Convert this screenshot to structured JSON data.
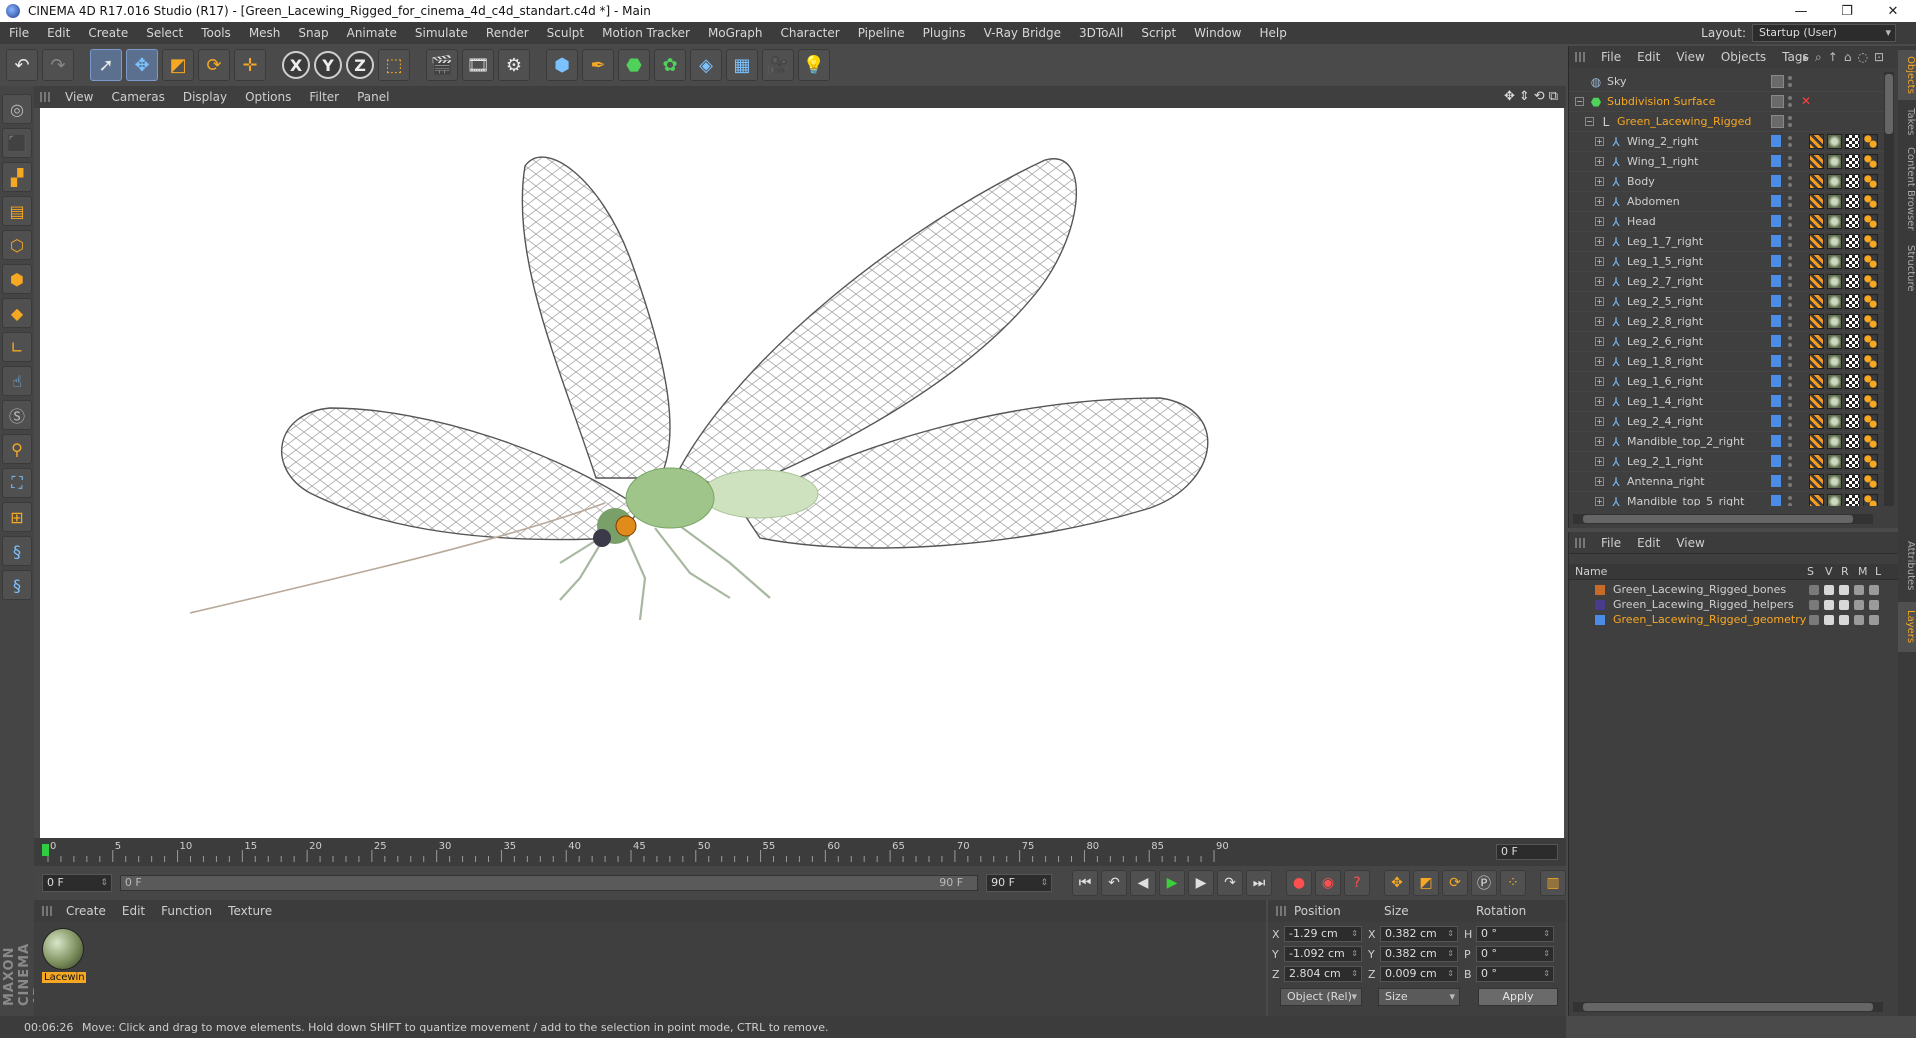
{
  "window": {
    "title": "CINEMA 4D R17.016 Studio (R17) - [Green_Lacewing_Rigged_for_cinema_4d_c4d_standart.c4d *] - Main",
    "controls": [
      "—",
      "❐",
      "✕"
    ]
  },
  "menubar": {
    "items": [
      "File",
      "Edit",
      "Create",
      "Select",
      "Tools",
      "Mesh",
      "Snap",
      "Animate",
      "Simulate",
      "Render",
      "Sculpt",
      "Motion Tracker",
      "MoGraph",
      "Character",
      "Pipeline",
      "Plugins",
      "V-Ray Bridge",
      "3DToAll",
      "Script",
      "Window",
      "Help"
    ],
    "layout_label": "Layout:",
    "layout_value": "Startup (User)"
  },
  "toolbar": {
    "icons": [
      "undo-icon",
      "redo-icon",
      "select-arrow-icon",
      "move-icon",
      "scale-icon",
      "rotate-icon",
      "live-move-icon",
      "x-axis-icon",
      "y-axis-icon",
      "z-axis-icon",
      "coordinate-system-icon",
      "render-view-icon",
      "render-picture-viewer-icon",
      "render-settings-icon",
      "cube-icon",
      "pen-icon",
      "subdivision-icon",
      "cloner-icon",
      "deformer-icon",
      "floor-icon",
      "camera-icon",
      "light-icon"
    ],
    "axis_labels": [
      "X",
      "Y",
      "Z"
    ]
  },
  "viewport": {
    "menu": [
      "View",
      "Cameras",
      "Display",
      "Options",
      "Filter",
      "Panel"
    ],
    "nav_icons": [
      "✥",
      "⇕",
      "⟲",
      "⧉"
    ]
  },
  "timeline": {
    "ticks": [
      "0",
      "5",
      "10",
      "15",
      "20",
      "25",
      "30",
      "35",
      "40",
      "45",
      "50",
      "55",
      "60",
      "65",
      "70",
      "75",
      "80",
      "85",
      "90"
    ],
    "current_frame": "0 F"
  },
  "transport": {
    "start_field": "0 F",
    "range_left": "0 F",
    "range_right": "90 F",
    "end_field": "90 F"
  },
  "material_manager": {
    "menu": [
      "Create",
      "Edit",
      "Function",
      "Texture"
    ],
    "materials": [
      {
        "label": "Lacewin"
      }
    ]
  },
  "coordinates": {
    "headers": [
      "Position",
      "Size",
      "Rotation"
    ],
    "rows": [
      {
        "axis": "X",
        "pos": "-1.29 cm",
        "size_axis": "X",
        "size": "0.382 cm",
        "rot_axis": "H",
        "rot": "0 °"
      },
      {
        "axis": "Y",
        "pos": "-1.092 cm",
        "size_axis": "Y",
        "size": "0.382 cm",
        "rot_axis": "P",
        "rot": "0 °"
      },
      {
        "axis": "Z",
        "pos": "2.804 cm",
        "size_axis": "Z",
        "size": "0.009 cm",
        "rot_axis": "B",
        "rot": "0 °"
      }
    ],
    "mode": "Object (Rel)",
    "size_mode": "Size",
    "apply": "Apply"
  },
  "statusbar": {
    "time": "00:06:26",
    "message": "Move: Click and drag to move elements. Hold down SHIFT to quantize movement / add to the selection in point mode, CTRL to remove."
  },
  "object_manager": {
    "menu": [
      "File",
      "Edit",
      "View",
      "Objects",
      "Tags"
    ],
    "objects": [
      {
        "name": "Sky",
        "depth": 0,
        "kind": "sky",
        "orange": false,
        "expand": ""
      },
      {
        "name": "Subdivision Surface",
        "depth": 0,
        "kind": "subd",
        "orange": true,
        "expand": "−"
      },
      {
        "name": "Green_Lacewing_Rigged",
        "depth": 1,
        "kind": "null",
        "orange": true,
        "expand": "−"
      },
      {
        "name": "Wing_2_right",
        "depth": 2,
        "kind": "joint",
        "orange": false,
        "expand": "+"
      },
      {
        "name": "Wing_1_right",
        "depth": 2,
        "kind": "joint",
        "orange": false,
        "expand": "+"
      },
      {
        "name": "Body",
        "depth": 2,
        "kind": "joint",
        "orange": false,
        "expand": "+"
      },
      {
        "name": "Abdomen",
        "depth": 2,
        "kind": "joint",
        "orange": false,
        "expand": "+"
      },
      {
        "name": "Head",
        "depth": 2,
        "kind": "joint",
        "orange": false,
        "expand": "+"
      },
      {
        "name": "Leg_1_7_right",
        "depth": 2,
        "kind": "joint",
        "orange": false,
        "expand": "+"
      },
      {
        "name": "Leg_1_5_right",
        "depth": 2,
        "kind": "joint",
        "orange": false,
        "expand": "+"
      },
      {
        "name": "Leg_2_7_right",
        "depth": 2,
        "kind": "joint",
        "orange": false,
        "expand": "+"
      },
      {
        "name": "Leg_2_5_right",
        "depth": 2,
        "kind": "joint",
        "orange": false,
        "expand": "+"
      },
      {
        "name": "Leg_2_8_right",
        "depth": 2,
        "kind": "joint",
        "orange": false,
        "expand": "+"
      },
      {
        "name": "Leg_2_6_right",
        "depth": 2,
        "kind": "joint",
        "orange": false,
        "expand": "+"
      },
      {
        "name": "Leg_1_8_right",
        "depth": 2,
        "kind": "joint",
        "orange": false,
        "expand": "+"
      },
      {
        "name": "Leg_1_6_right",
        "depth": 2,
        "kind": "joint",
        "orange": false,
        "expand": "+"
      },
      {
        "name": "Leg_1_4_right",
        "depth": 2,
        "kind": "joint",
        "orange": false,
        "expand": "+"
      },
      {
        "name": "Leg_2_4_right",
        "depth": 2,
        "kind": "joint",
        "orange": false,
        "expand": "+"
      },
      {
        "name": "Mandible_top_2_right",
        "depth": 2,
        "kind": "joint",
        "orange": false,
        "expand": "+"
      },
      {
        "name": "Leg_2_1_right",
        "depth": 2,
        "kind": "joint",
        "orange": false,
        "expand": "+"
      },
      {
        "name": "Antenna_right",
        "depth": 2,
        "kind": "joint",
        "orange": false,
        "expand": "+"
      },
      {
        "name": "Mandible_top_5_right",
        "depth": 2,
        "kind": "joint",
        "orange": false,
        "expand": "+"
      }
    ]
  },
  "layer_manager": {
    "menu": [
      "File",
      "Edit",
      "View"
    ],
    "columns": [
      "Name",
      "S",
      "V",
      "R",
      "M",
      "L"
    ],
    "layers": [
      {
        "name": "Green_Lacewing_Rigged_bones",
        "color": "#c86a2a",
        "active": false
      },
      {
        "name": "Green_Lacewing_Rigged_helpers",
        "color": "#4a3a8a",
        "active": false
      },
      {
        "name": "Green_Lacewing_Rigged_geometry",
        "color": "#4b8de6",
        "active": true
      }
    ]
  },
  "side_tabs": [
    "Objects",
    "Takes",
    "Content Browser",
    "Structure",
    "Attributes",
    "Layers"
  ],
  "colors": {
    "accent_orange": "#f7a823",
    "panel_bg": "#3f3f3f",
    "selection_blue": "#4b8de6"
  },
  "maxon_logo": "MAXON CINEMA 4D"
}
